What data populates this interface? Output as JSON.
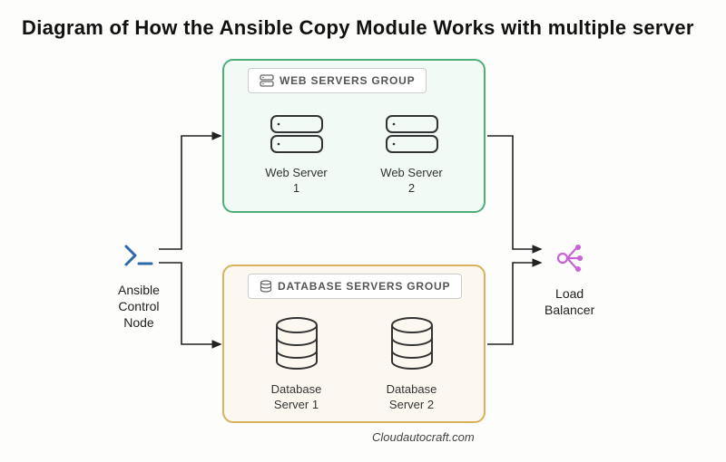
{
  "title": "Diagram of How the Ansible Copy Module Works with multiple server",
  "attribution": "Cloudautocraft.com",
  "control_node": {
    "label": "Ansible\nControl\nNode"
  },
  "load_balancer": {
    "label": "Load\nBalancer"
  },
  "web_group": {
    "header": "WEB SERVERS GROUP",
    "servers": [
      {
        "label": "Web Server\n1"
      },
      {
        "label": "Web Server\n2"
      }
    ]
  },
  "db_group": {
    "header": "DATABASE SERVERS GROUP",
    "servers": [
      {
        "label": "Database\nServer 1"
      },
      {
        "label": "Database\nServer 2"
      }
    ]
  },
  "colors": {
    "web_border": "#4caf7a",
    "web_bg": "#f1faf4",
    "db_border": "#d9b15a",
    "db_bg": "#fcf8ef",
    "lb_accent": "#c862d6"
  }
}
